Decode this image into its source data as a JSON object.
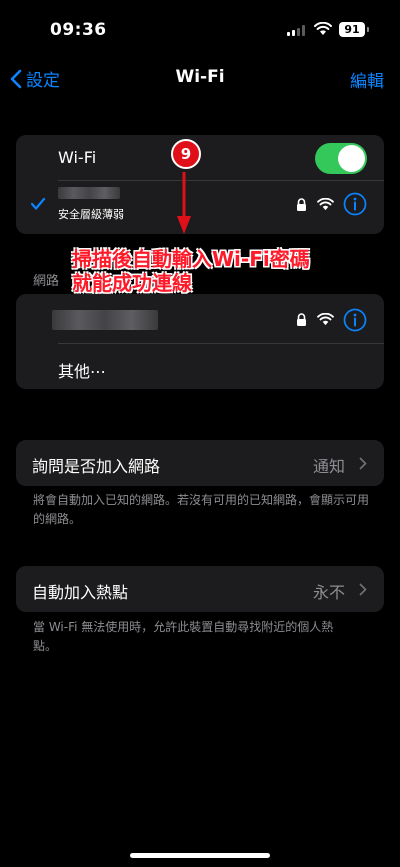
{
  "status_bar": {
    "time": "09:36",
    "battery": "91"
  },
  "nav": {
    "back_label": "設定",
    "title": "Wi-Fi",
    "edit_label": "編輯"
  },
  "wifi_card": {
    "wifi_label": "Wi-Fi",
    "wifi_enabled": true,
    "connected_security": "安全層級薄弱"
  },
  "annotation": {
    "step": "9",
    "line1": "掃描後自動輸入Wi-Fi密碼",
    "line2": "就能成功連線"
  },
  "networks": {
    "section_header": "網路",
    "other_label": "其他⋯"
  },
  "ask_join": {
    "label": "詢問是否加入網路",
    "value": "通知",
    "footer": "將會自動加入已知的網路。若沒有可用的已知網路，會顯示可用的網路。"
  },
  "auto_hotspot": {
    "label": "自動加入熱點",
    "value": "永不",
    "footer": "當 Wi-Fi 無法使用時，允許此裝置自動尋找附近的個人熱點。"
  },
  "colors": {
    "accent": "#0a84ff",
    "toggle_on": "#34c759",
    "annotation_red": "#e0101a"
  }
}
